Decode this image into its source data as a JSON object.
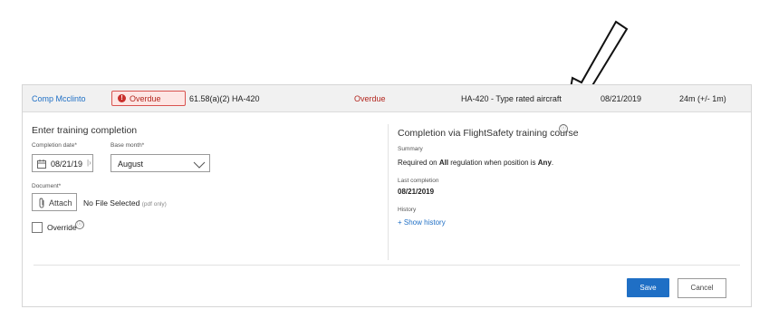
{
  "row": {
    "name": "Comp Mcclinto",
    "status_badge": "Overdue",
    "regulation": "61.58(a)(2) HA-420",
    "status_text": "Overdue",
    "course": "HA-420 - Type rated aircraft",
    "date": "08/21/2019",
    "interval": "24m (+/- 1m)"
  },
  "left": {
    "title": "Enter training completion",
    "completion_date_label": "Completion date*",
    "completion_date_value": "08/21/19",
    "base_month_label": "Base month*",
    "base_month_value": "August",
    "document_label": "Document*",
    "attach_label": "Attach",
    "no_file_text": "No File Selected",
    "pdf_only": "(pdf only)",
    "override_label": "Override"
  },
  "right": {
    "title": "Completion via FlightSafety training course",
    "summary_label": "Summary",
    "summary_prefix": "Required on ",
    "summary_all": "All",
    "summary_mid": " regulation when position is ",
    "summary_any": "Any",
    "summary_suffix": ".",
    "last_completion_label": "Last completion",
    "last_completion_value": "08/21/2019",
    "history_label": "History",
    "show_history": "+ Show history"
  },
  "footer": {
    "save": "Save",
    "cancel": "Cancel"
  },
  "icons": {
    "info": "ⓘ",
    "calendar": "calendar-icon",
    "paperclip": "paperclip-icon",
    "chevron": "chevron-down-icon"
  },
  "colors": {
    "accent": "#1f6fc5",
    "overdue": "#b3261e"
  }
}
